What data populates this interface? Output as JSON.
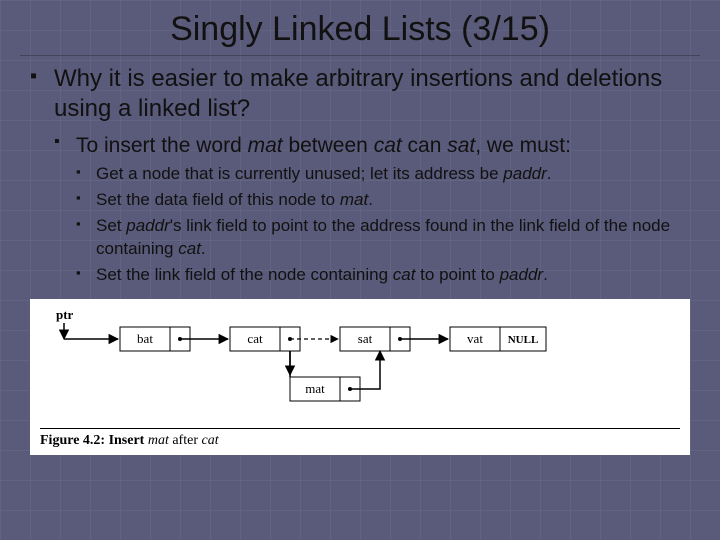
{
  "title": "Singly Linked Lists (3/15)",
  "bullets": {
    "l1": "Why it is easier to make arbitrary insertions and deletions using a linked list?",
    "l2_pre": "To insert the word ",
    "l2_mat": "mat",
    "l2_mid1": " between ",
    "l2_cat": "cat",
    "l2_mid2": " can ",
    "l2_sat": "sat",
    "l2_post": ", we must:",
    "l3a_pre": "Get a node that is currently unused; let its address be ",
    "l3a_paddr": "paddr",
    "l3a_post": ".",
    "l3b_pre": "Set the data field of this node to ",
    "l3b_mat": "mat",
    "l3b_post": ".",
    "l3c_pre": "Set ",
    "l3c_paddr": "paddr",
    "l3c_mid": "'s link field to point to the address found in the link field of the node containing ",
    "l3c_cat": "cat",
    "l3c_post": ".",
    "l3d_pre": "Set the link field of the node containing ",
    "l3d_cat": "cat",
    "l3d_mid": " to point to ",
    "l3d_paddr": "paddr",
    "l3d_post": "."
  },
  "diagram": {
    "ptr": "ptr",
    "nodes": [
      "bat",
      "cat",
      "sat",
      "vat",
      "mat"
    ],
    "null": "NULL"
  },
  "caption": {
    "pre": "Figure 4.2: Insert ",
    "mat": "mat",
    "mid": " after ",
    "cat": "cat"
  }
}
